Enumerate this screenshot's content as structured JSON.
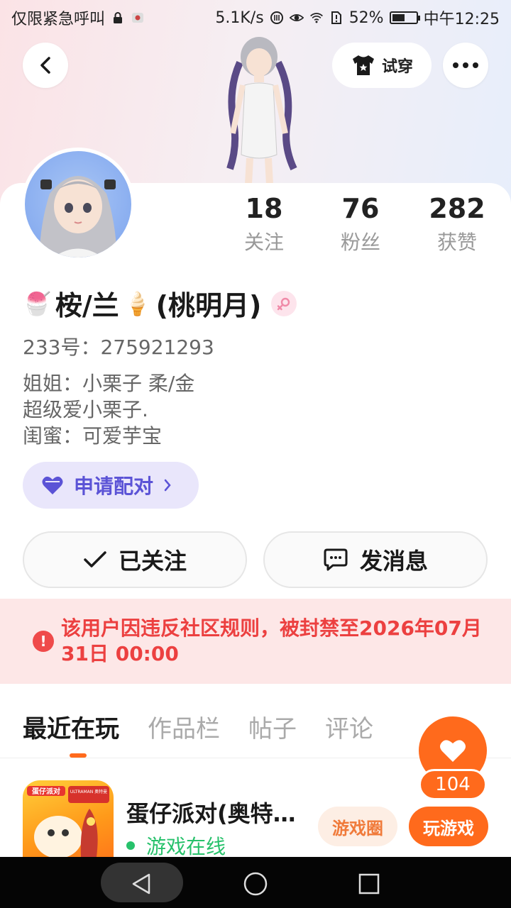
{
  "status_bar": {
    "left_text": "仅限紧急呼叫",
    "speed": "5.1K/s",
    "battery_text": "52%",
    "battery_level": 0.52,
    "time": "中午12:25"
  },
  "header": {
    "tryon_label": "试穿"
  },
  "stats": [
    {
      "num": "18",
      "label": "关注"
    },
    {
      "num": "76",
      "label": "粉丝"
    },
    {
      "num": "282",
      "label": "获赞"
    }
  ],
  "profile": {
    "name_emoji_left": "🍧",
    "name": "桉/兰",
    "name_emoji_right": "🍦",
    "name_suffix": "(桃明月)",
    "uid": "233号：275921293",
    "bio": [
      "姐姐：小栗子 柔/金",
      "超级爱小栗子.",
      "闺蜜：可爱芋宝"
    ]
  },
  "pair_button": {
    "label": "申请配对"
  },
  "actions": {
    "follow_label": "已关注",
    "message_label": "发消息"
  },
  "ban_notice": "该用户因违反社区规则，被封禁至2026年07月31日 00:00",
  "tabs": [
    {
      "label": "最近在玩",
      "active": true
    },
    {
      "label": "作品栏",
      "active": false
    },
    {
      "label": "帖子",
      "active": false
    },
    {
      "label": "评论",
      "active": false
    }
  ],
  "game": {
    "title": "蛋仔派对(奥特…",
    "status": "游戏在线",
    "circle_label": "游戏圈",
    "play_label": "玩游戏",
    "icon_text_a": "蛋仔派对",
    "icon_text_b": "ULTRAMAN 奥特曼"
  },
  "fab": {
    "count": "104"
  },
  "colors": {
    "accent": "#ff6a1c",
    "ban_red": "#ec4040",
    "pair_purple": "#5b53d6",
    "online_green": "#27c16b"
  }
}
